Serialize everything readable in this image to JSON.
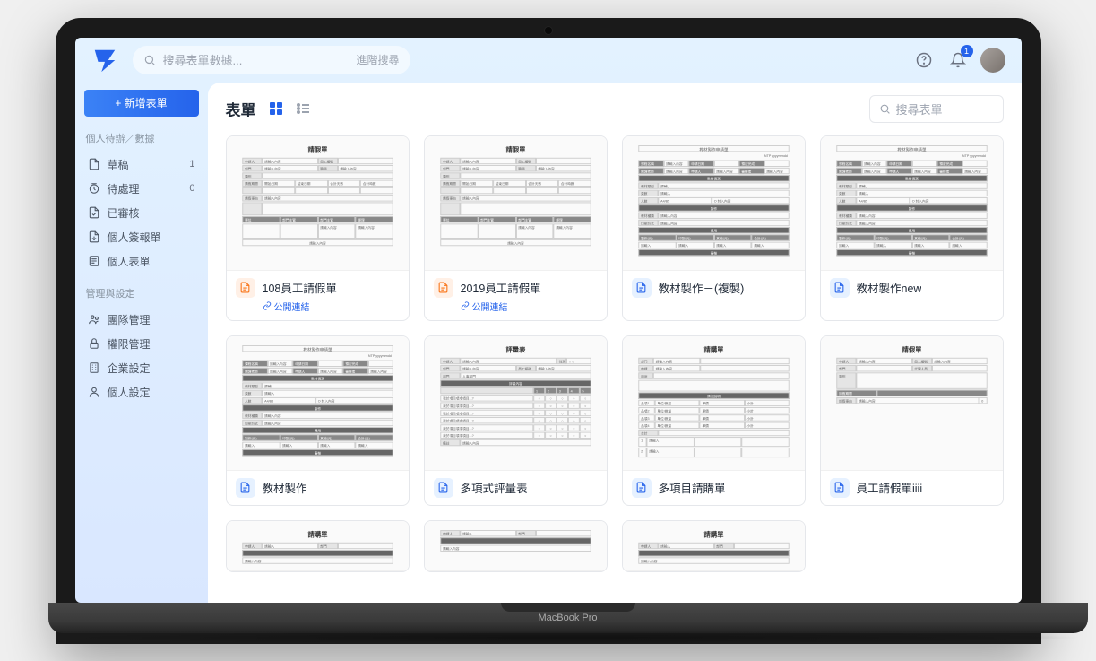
{
  "device_label": "MacBook Pro",
  "topbar": {
    "search_placeholder": "搜尋表單數據...",
    "advanced_search": "進階搜尋",
    "notification_count": "1"
  },
  "sidebar": {
    "new_form_button": "+ 新增表單",
    "section1_label": "個人待辦／數據",
    "items1": [
      {
        "icon": "draft",
        "label": "草稿",
        "count": "1"
      },
      {
        "icon": "clock",
        "label": "待處理",
        "count": "0"
      },
      {
        "icon": "file",
        "label": "已審核",
        "count": ""
      },
      {
        "icon": "signed",
        "label": "個人簽報單",
        "count": ""
      },
      {
        "icon": "form",
        "label": "個人表單",
        "count": ""
      }
    ],
    "section2_label": "管理與設定",
    "items2": [
      {
        "icon": "team",
        "label": "團隊管理"
      },
      {
        "icon": "lock",
        "label": "權限管理"
      },
      {
        "icon": "building",
        "label": "企業設定"
      },
      {
        "icon": "user",
        "label": "個人設定"
      }
    ]
  },
  "main": {
    "title": "表單",
    "search_placeholder": "搜尋表單"
  },
  "forms": [
    {
      "title": "108員工請假單",
      "public_link": "公開連結",
      "icon": "orange",
      "preview_title": "請假單",
      "preview_kind": "leave"
    },
    {
      "title": "2019員工請假單",
      "public_link": "公開連結",
      "icon": "orange",
      "preview_title": "請假單",
      "preview_kind": "leave"
    },
    {
      "title": "教材製作－(複製)",
      "public_link": "",
      "icon": "blue",
      "preview_title": "教材製作申請單",
      "preview_kind": "material"
    },
    {
      "title": "教材製作new",
      "public_link": "",
      "icon": "blue",
      "preview_title": "教材製作申請單",
      "preview_kind": "material"
    },
    {
      "title": "教材製作",
      "public_link": "",
      "icon": "blue",
      "preview_title": "教材製作申請單",
      "preview_kind": "material"
    },
    {
      "title": "多項式評量表",
      "public_link": "",
      "icon": "blue",
      "preview_title": "評量表",
      "preview_kind": "eval"
    },
    {
      "title": "多項目請購單",
      "public_link": "",
      "icon": "blue",
      "preview_title": "請購單",
      "preview_kind": "purchase"
    },
    {
      "title": "員工請假單iiii",
      "public_link": "",
      "icon": "blue",
      "preview_title": "請假單",
      "preview_kind": "leave2"
    },
    {
      "title": "",
      "public_link": "",
      "icon": "",
      "preview_title": "請購單",
      "preview_kind": "partial"
    },
    {
      "title": "",
      "public_link": "",
      "icon": "",
      "preview_title": "",
      "preview_kind": "partial"
    },
    {
      "title": "",
      "public_link": "",
      "icon": "",
      "preview_title": "請購單",
      "preview_kind": "partial"
    }
  ]
}
